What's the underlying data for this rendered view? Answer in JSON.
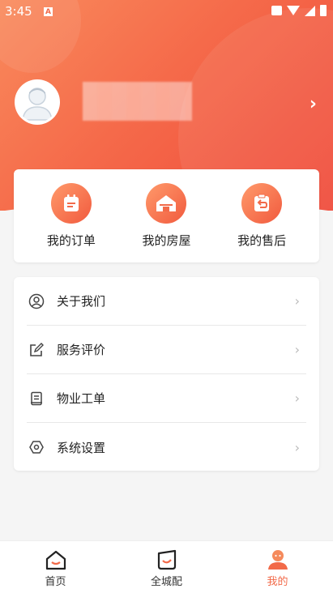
{
  "status_bar": {
    "time": "3:45",
    "notification_badge": "A"
  },
  "profile": {
    "username": "████████"
  },
  "orders": [
    {
      "label": "我的订单",
      "icon": "clipboard-icon"
    },
    {
      "label": "我的房屋",
      "icon": "house-icon"
    },
    {
      "label": "我的售后",
      "icon": "return-icon"
    }
  ],
  "menu": [
    {
      "label": "关于我们",
      "icon": "user-circle-icon"
    },
    {
      "label": "服务评价",
      "icon": "edit-icon"
    },
    {
      "label": "物业工单",
      "icon": "document-icon"
    },
    {
      "label": "系统设置",
      "icon": "settings-hex-icon"
    }
  ],
  "tabs": [
    {
      "label": "首页",
      "icon": "home-icon"
    },
    {
      "label": "全城配",
      "icon": "smile-box-icon"
    },
    {
      "label": "我的",
      "icon": "profile-icon"
    }
  ],
  "colors": {
    "accent": "#f26a49",
    "header_start": "#f98a5c",
    "header_end": "#ef4a3a"
  }
}
